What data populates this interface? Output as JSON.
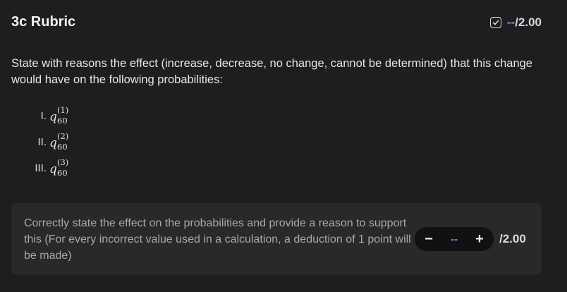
{
  "header": {
    "title": "3c Rubric",
    "score_dash": "--",
    "score_max": "/2.00",
    "icon": "checkbox-icon"
  },
  "question": {
    "text": "State with reasons the effect (increase, decrease, no change, cannot be determined) that this change would have on the following probabilities:"
  },
  "probabilities": [
    {
      "numeral": "I.",
      "base": "q",
      "sup": "(1)",
      "sub": "60"
    },
    {
      "numeral": "II.",
      "base": "q",
      "sup": "(2)",
      "sub": "60"
    },
    {
      "numeral": "III.",
      "base": "q",
      "sup": "(3)",
      "sub": "60"
    }
  ],
  "criterion": {
    "text": "Correctly state the effect on the probabilities and provide a reason to support this (For every incorrect value used in a calculation, a deduction of 1 point will be made)",
    "decrement_label": "−",
    "value": "--",
    "increment_label": "+",
    "max": "/2.00"
  },
  "colors": {
    "background": "#1e1e20",
    "card": "#29292c",
    "accent": "#a47cf0"
  }
}
